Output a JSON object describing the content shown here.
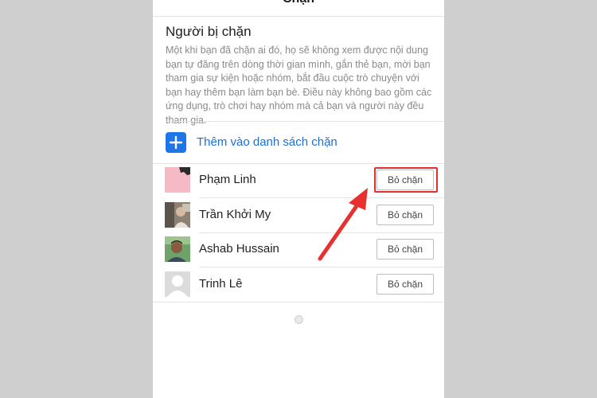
{
  "nav": {
    "title": "Chặn"
  },
  "section": {
    "title": "Người bị chặn",
    "description": "Một khi bạn đã chặn ai đó, họ sẽ không xem được nội dung bạn tự đăng trên dòng thời gian mình, gắn thẻ bạn, mời bạn tham gia sự kiện hoặc nhóm, bắt đầu cuộc trò chuyện với bạn hay thêm bạn làm bạn bè. Điều này không bao gồm các ứng dụng, trò chơi hay nhóm mà cả bạn và người này đều tham gia."
  },
  "add_row": {
    "label": "Thêm vào danh sách chặn",
    "icon": "plus-icon"
  },
  "blocked": [
    {
      "name": "Phạm Linh",
      "button": "Bỏ chặn"
    },
    {
      "name": "Trần Khởi My",
      "button": "Bỏ chặn"
    },
    {
      "name": "Ashab Hussain",
      "button": "Bỏ chặn"
    },
    {
      "name": "Trinh Lê",
      "button": "Bỏ chặn"
    }
  ],
  "colors": {
    "accent": "#1d75e8",
    "annotation": "#e23030",
    "background": "#cfcfcf"
  }
}
